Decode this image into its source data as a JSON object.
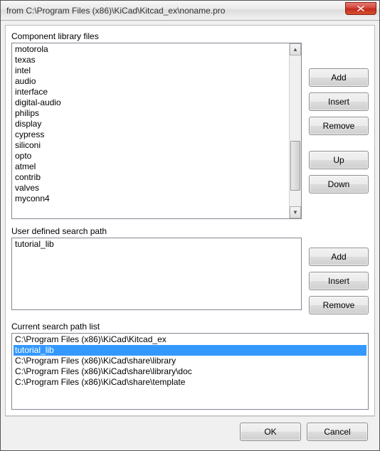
{
  "window": {
    "title": "from C:\\Program Files (x86)\\KiCad\\Kitcad_ex\\noname.pro"
  },
  "componentLibs": {
    "label": "Component library files",
    "items": [
      "motorola",
      "texas",
      "intel",
      "audio",
      "interface",
      "digital-audio",
      "philips",
      "display",
      "cypress",
      "siliconi",
      "opto",
      "atmel",
      "contrib",
      "valves",
      "myconn4"
    ],
    "buttons": {
      "add": "Add",
      "insert": "Insert",
      "remove": "Remove",
      "up": "Up",
      "down": "Down"
    }
  },
  "userPaths": {
    "label": "User defined search path",
    "items": [
      "tutorial_lib"
    ],
    "buttons": {
      "add": "Add",
      "insert": "Insert",
      "remove": "Remove"
    }
  },
  "currentPaths": {
    "label": "Current search path list",
    "items": [
      "C:\\Program Files (x86)\\KiCad\\Kitcad_ex",
      "tutorial_lib",
      "C:\\Program Files (x86)\\KiCad\\share\\library",
      "C:\\Program Files (x86)\\KiCad\\share\\library\\doc",
      "C:\\Program Files (x86)\\KiCad\\share\\template"
    ],
    "selectedIndex": 1
  },
  "footer": {
    "ok": "OK",
    "cancel": "Cancel"
  }
}
